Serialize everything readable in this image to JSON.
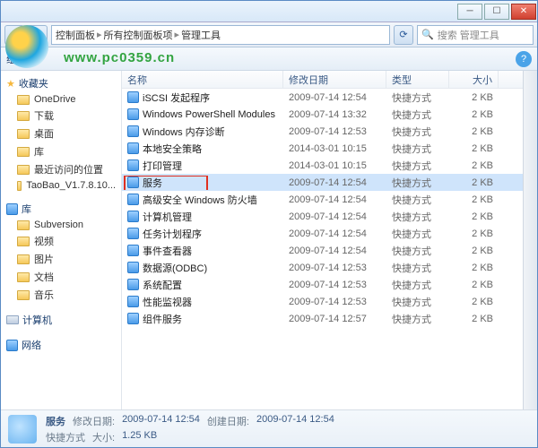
{
  "titlebar": {
    "min": "─",
    "max": "☐",
    "close": "✕"
  },
  "addr": {
    "back": "◀",
    "fwd": "▶",
    "up": "▲",
    "crumbs": [
      "控制面板",
      "所有控制面板项",
      "管理工具"
    ],
    "sep": "▸",
    "refresh": "⟳",
    "search_placeholder": "搜索 管理工具",
    "search_icon": "🔍"
  },
  "watermark": "www.pc0359.cn",
  "toolbar": {
    "organize": "组织 ▾",
    "help": "?"
  },
  "nav": {
    "fav": "收藏夹",
    "fav_items": [
      {
        "icon": "cloud",
        "label": "OneDrive"
      },
      {
        "icon": "dl",
        "label": "下载"
      },
      {
        "icon": "desk",
        "label": "桌面"
      },
      {
        "icon": "lib",
        "label": "库"
      },
      {
        "icon": "recent",
        "label": "最近访问的位置"
      },
      {
        "icon": "file",
        "label": "TaoBao_V1.7.8.10..."
      }
    ],
    "lib": "库",
    "lib_items": [
      {
        "icon": "svn",
        "label": "Subversion"
      },
      {
        "icon": "vid",
        "label": "视频"
      },
      {
        "icon": "pic",
        "label": "图片"
      },
      {
        "icon": "doc",
        "label": "文档"
      },
      {
        "icon": "mus",
        "label": "音乐"
      }
    ],
    "computer": "计算机",
    "network": "网络"
  },
  "columns": {
    "name": "名称",
    "date": "修改日期",
    "type": "类型",
    "size": "大小"
  },
  "files": [
    {
      "n": "iSCSI 发起程序",
      "d": "2009-07-14 12:54",
      "t": "快捷方式",
      "s": "2 KB"
    },
    {
      "n": "Windows PowerShell Modules",
      "d": "2009-07-14 13:32",
      "t": "快捷方式",
      "s": "2 KB"
    },
    {
      "n": "Windows 内存诊断",
      "d": "2009-07-14 12:53",
      "t": "快捷方式",
      "s": "2 KB"
    },
    {
      "n": "本地安全策略",
      "d": "2014-03-01 10:15",
      "t": "快捷方式",
      "s": "2 KB"
    },
    {
      "n": "打印管理",
      "d": "2014-03-01 10:15",
      "t": "快捷方式",
      "s": "2 KB"
    },
    {
      "n": "服务",
      "d": "2009-07-14 12:54",
      "t": "快捷方式",
      "s": "2 KB",
      "sel": true,
      "hl": true
    },
    {
      "n": "高级安全 Windows 防火墙",
      "d": "2009-07-14 12:54",
      "t": "快捷方式",
      "s": "2 KB"
    },
    {
      "n": "计算机管理",
      "d": "2009-07-14 12:54",
      "t": "快捷方式",
      "s": "2 KB"
    },
    {
      "n": "任务计划程序",
      "d": "2009-07-14 12:54",
      "t": "快捷方式",
      "s": "2 KB"
    },
    {
      "n": "事件查看器",
      "d": "2009-07-14 12:54",
      "t": "快捷方式",
      "s": "2 KB"
    },
    {
      "n": "数据源(ODBC)",
      "d": "2009-07-14 12:53",
      "t": "快捷方式",
      "s": "2 KB"
    },
    {
      "n": "系统配置",
      "d": "2009-07-14 12:53",
      "t": "快捷方式",
      "s": "2 KB"
    },
    {
      "n": "性能监视器",
      "d": "2009-07-14 12:53",
      "t": "快捷方式",
      "s": "2 KB"
    },
    {
      "n": "组件服务",
      "d": "2009-07-14 12:57",
      "t": "快捷方式",
      "s": "2 KB"
    }
  ],
  "status": {
    "name": "服务",
    "type_k": "快捷方式",
    "mod_k": "修改日期:",
    "mod_v": "2009-07-14 12:54",
    "size_k": "大小:",
    "size_v": "1.25 KB",
    "create_k": "创建日期:",
    "create_v": "2009-07-14 12:54"
  }
}
